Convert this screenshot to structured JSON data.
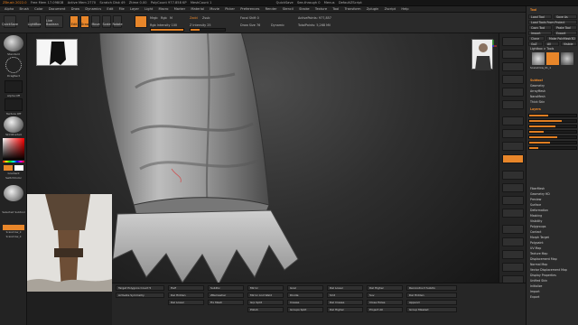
{
  "titlebar": {
    "app": "ZBrush 2022.0",
    "items": [
      "Free Mem 17.098GB",
      "Active Mem 2770",
      "Scratch Disk 49",
      "Ztime 0.00",
      "PolyCount 977.858 KP",
      "MeshCount 1"
    ],
    "right": [
      "QuickSave",
      "See-through 0",
      "Menus",
      "DefaultZScript"
    ]
  },
  "menubar": [
    "Alpha",
    "Brush",
    "Color",
    "Document",
    "Draw",
    "Dynamics",
    "Edit",
    "File",
    "Layer",
    "Light",
    "Macro",
    "Marker",
    "Material",
    "Movie",
    "Picker",
    "Preferences",
    "Render",
    "Stencil",
    "Stroke",
    "Texture",
    "Tool",
    "Transform",
    "Zplugin",
    "Zscript",
    "Help"
  ],
  "toolbar": {
    "buttons": [
      {
        "label": "QuickSave",
        "on": false
      },
      {
        "label": "LightBox",
        "on": false
      },
      {
        "label": "Live Boolean",
        "on": false
      },
      {
        "label": "Edit",
        "on": true
      },
      {
        "label": "Draw",
        "on": true
      },
      {
        "label": "Move",
        "on": false
      },
      {
        "label": "Scale",
        "on": false
      },
      {
        "label": "Rotate",
        "on": false
      }
    ],
    "labels": {
      "mrgb": "Mrgb",
      "rgb": "Rgb",
      "m": "M",
      "zadd": "Zadd",
      "zsub": "Zsub",
      "zcut": "Zcut",
      "focal": "Focal Shift 0",
      "draw_size": "Draw Size 76",
      "rgb_int": "Rgb Intensity 100",
      "z_int": "Z Intensity 25",
      "active_pts": "ActivePoints: 977,857",
      "total_pts": "TotalPoints: 5,268 Mil",
      "dynamic": "Dynamic"
    },
    "slider_fill": {
      "rgb_int": 1.0,
      "z_int": 0.25
    }
  },
  "leftshelf": {
    "brush_label": "Standard",
    "stroke_label": "DragRect",
    "alpha_label": "Alpha Off",
    "texture_label": "Texture Off",
    "material_label": "SkinShade4",
    "switch_color": "SwitchColor",
    "gradient": "Gradient",
    "selected_subtool": "Selected Subtool",
    "subtool_name": "Sphere 3D",
    "scarecrow": "ScareCrow_0",
    "scarecrow2": "ScareCrow_0"
  },
  "viewport": {
    "bg_color": "#2f2f2f",
    "axis_colors": {
      "x": "#e33",
      "y": "#3c3",
      "z": "#33e"
    }
  },
  "bottombar": {
    "rows": [
      [
        "Target Polygons Count 5",
        "Half",
        "SubDiv",
        "Mirror",
        "Goal",
        "Del Lower",
        "Del Higher",
        "Reconstruct Subdiv"
      ],
      [
        "Activate Symmetry",
        "Del Hidden",
        "ZRemesher",
        "Mirror And Weld",
        "Divide",
        "Smt",
        "Suv",
        "Del Hidden"
      ],
      [
        "",
        "Del Lower",
        "Fix Mesh",
        "Grp Split",
        "Crease",
        "Del Crease",
        "Close Holes",
        "Append"
      ],
      [
        "",
        "",
        "",
        "Polish",
        "Groups Split",
        "Del Higher",
        "Project All",
        "Group Masked"
      ]
    ]
  },
  "palette": {
    "rows": [
      "Tool",
      "Load Tool",
      "Save As",
      "Load Tools From Project",
      "Copy Tool",
      "Paste Tool",
      "Import",
      "Export",
      "Clone",
      "Make PolyMesh3D",
      "GoZ",
      "All",
      "Visible",
      "Lightbox > Tools",
      "ScareCrow_01_1",
      "Subtool",
      "Geometry",
      "ArrayMesh",
      "NanoMesh",
      "Thick Skin",
      "Layers",
      "FiberMesh",
      "Geometry HD",
      "Preview",
      "Surface",
      "Deformation",
      "Masking",
      "Visibility",
      "Polygroups",
      "Contact",
      "Morph Target",
      "Polypaint",
      "UV Map",
      "Texture Map",
      "Displacement Map",
      "Normal Map",
      "Vector Displacement Map",
      "Display Properties",
      "Unified Skin",
      "Initialize",
      "Import",
      "Export"
    ]
  }
}
